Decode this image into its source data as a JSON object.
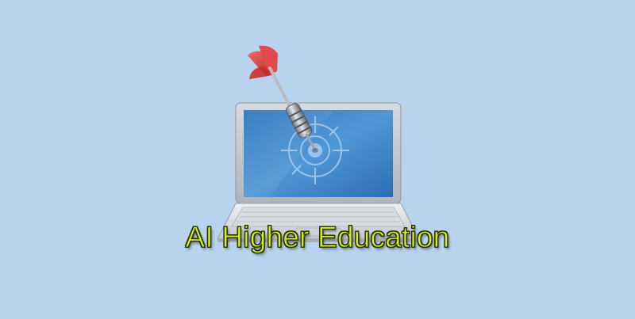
{
  "headline": "AI Higher Education",
  "icons": [
    "laptop-icon",
    "target-icon",
    "dart-icon"
  ],
  "colors": {
    "background": "#b9d3ee",
    "headline_fill": "#d9f21a",
    "headline_outline": "#1f2806",
    "screen_blue": "#3f86c9",
    "dart_red": "#d93a3a"
  }
}
